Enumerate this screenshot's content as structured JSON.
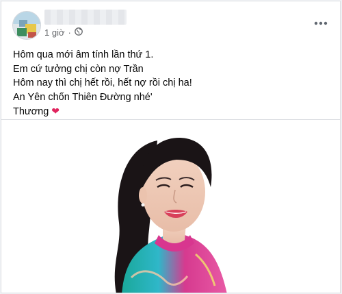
{
  "post": {
    "author_name": "",
    "time": "1 giờ",
    "separator": "·",
    "privacy_icon": "globe-icon",
    "more_icon": "more-options-icon",
    "lines": [
      "Hôm qua mới âm tính lần thứ 1.",
      "Em cứ tưởng chị còn nợ Trần",
      "Hôm nay thì chị hết rồi, hết nợ rồi chị ha!",
      "An Yên chốn Thiên Đường nhé'",
      "Thương"
    ],
    "heart_glyph": "❤",
    "photo_alt": "portrait-photo"
  },
  "colors": {
    "meta_text": "#65676b",
    "text": "#050505",
    "heart": "#e0245e"
  }
}
